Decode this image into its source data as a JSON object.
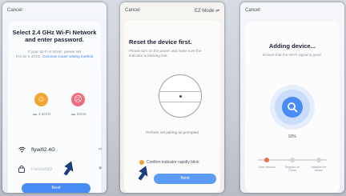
{
  "screens": [
    {
      "cancel": "Cancel",
      "title_line1": "Select 2.4 GHz Wi-Fi Network",
      "title_line2": "and enter password.",
      "sub_line1": "If your Wi-Fi is 5GHz, please set",
      "sub_line2": "it to be 2.4GHz.",
      "sub_link": "Common router setting method",
      "band_ok": "2.4GHz",
      "band_bad": "5GHz",
      "ssid": "flywifi2.4G",
      "password_placeholder": "Password",
      "button": "Next"
    },
    {
      "cancel": "Cancel",
      "mode": "EZ Mode",
      "title": "Reset the device first.",
      "sub": "Please turn on the power and make sure the indicator is blinking fast.",
      "hint": "Perform net pairing as prompted",
      "confirm": "Confirm indicator rapidly blink",
      "button": "Next"
    },
    {
      "cancel": "Cancel",
      "title": "Adding device...",
      "sub": "Ensure that the Wi-Fi signal is good.",
      "percent": "93%",
      "steps": [
        "Scan devices",
        "Register on Cloud",
        "Initialize the device"
      ]
    }
  ],
  "colors": {
    "accent": "#4a8cf5",
    "radio": "#f0a23a",
    "step_active": "#ef6e4b"
  }
}
